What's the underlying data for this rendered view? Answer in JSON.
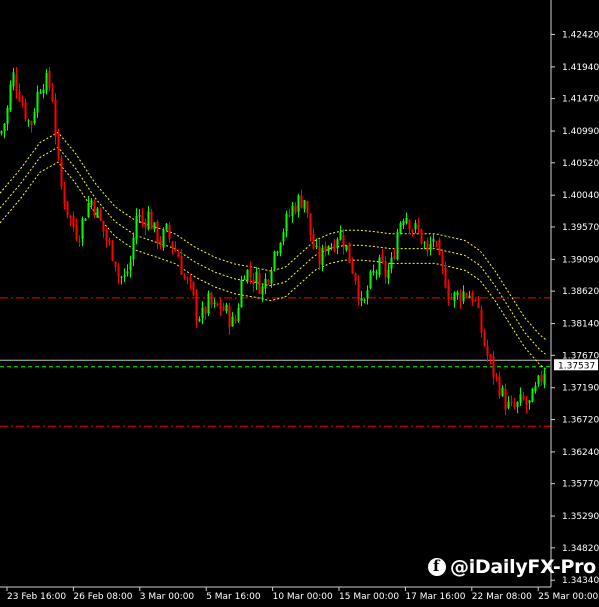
{
  "chart_data": {
    "type": "candlestick",
    "y_ticks": [
      "1.42420",
      "1.41940",
      "1.41470",
      "1.40990",
      "1.40520",
      "1.40040",
      "1.39570",
      "1.39090",
      "1.38620",
      "1.38140",
      "1.37670",
      "1.37190",
      "1.36720",
      "1.36240",
      "1.35770",
      "1.35290",
      "1.34820",
      "1.34340"
    ],
    "x_ticks": [
      "23 Feb 16:00",
      "26 Feb 08:00",
      "3 Mar 00:00",
      "5 Mar 16:00",
      "10 Mar 00:00",
      "15 Mar 00:00",
      "17 Mar 16:00",
      "22 Mar 08:00",
      "25 Mar 00:00"
    ],
    "ylim": [
      1.3424,
      1.4293
    ],
    "current_price": "1.37537",
    "horizontal_lines": [
      {
        "value": 1.3852,
        "color": "#ff0000",
        "style": "dash-dot"
      },
      {
        "value": 1.375,
        "color": "#00ff00",
        "style": "dashed"
      },
      {
        "value": 1.3662,
        "color": "#ff0000",
        "style": "dash-dot"
      }
    ],
    "envelope_color": "#ffff00",
    "bull_color": "#00ff00",
    "bear_color": "#ff0000",
    "close_path": [
      [
        0,
        1.4095
      ],
      [
        6,
        1.412
      ],
      [
        12,
        1.4185
      ],
      [
        18,
        1.416
      ],
      [
        24,
        1.413
      ],
      [
        30,
        1.4105
      ],
      [
        36,
        1.415
      ],
      [
        42,
        1.4175
      ],
      [
        48,
        1.417
      ],
      [
        52,
        1.415
      ],
      [
        56,
        1.408
      ],
      [
        60,
        1.402
      ],
      [
        64,
        1.4
      ],
      [
        68,
        1.3975
      ],
      [
        72,
        1.396
      ],
      [
        78,
        1.3945
      ],
      [
        84,
        1.3975
      ],
      [
        90,
        1.4
      ],
      [
        96,
        1.398
      ],
      [
        102,
        1.3955
      ],
      [
        108,
        1.393
      ],
      [
        114,
        1.3915
      ],
      [
        118,
        1.3885
      ],
      [
        124,
        1.388
      ],
      [
        130,
        1.3905
      ],
      [
        136,
        1.3975
      ],
      [
        142,
        1.3965
      ],
      [
        148,
        1.3975
      ],
      [
        154,
        1.395
      ],
      [
        160,
        1.3935
      ],
      [
        166,
        1.395
      ],
      [
        172,
        1.393
      ],
      [
        178,
        1.3915
      ],
      [
        184,
        1.388
      ],
      [
        190,
        1.3865
      ],
      [
        196,
        1.383
      ],
      [
        202,
        1.3825
      ],
      [
        208,
        1.3845
      ],
      [
        214,
        1.3835
      ],
      [
        220,
        1.384
      ],
      [
        226,
        1.383
      ],
      [
        232,
        1.3815
      ],
      [
        236,
        1.382
      ],
      [
        240,
        1.387
      ],
      [
        244,
        1.3895
      ],
      [
        250,
        1.3885
      ],
      [
        256,
        1.388
      ],
      [
        262,
        1.3865
      ],
      [
        268,
        1.389
      ],
      [
        274,
        1.392
      ],
      [
        280,
        1.3945
      ],
      [
        286,
        1.3965
      ],
      [
        292,
        1.3985
      ],
      [
        298,
        1.3995
      ],
      [
        304,
        1.4
      ],
      [
        308,
        1.396
      ],
      [
        314,
        1.392
      ],
      [
        320,
        1.3905
      ],
      [
        326,
        1.3935
      ],
      [
        332,
        1.393
      ],
      [
        338,
        1.395
      ],
      [
        344,
        1.3935
      ],
      [
        350,
        1.3905
      ],
      [
        356,
        1.388
      ],
      [
        362,
        1.383
      ],
      [
        368,
        1.387
      ],
      [
        374,
        1.389
      ],
      [
        380,
        1.39
      ],
      [
        386,
        1.3885
      ],
      [
        392,
        1.3905
      ],
      [
        398,
        1.396
      ],
      [
        404,
        1.398
      ],
      [
        408,
        1.397
      ],
      [
        412,
        1.3955
      ],
      [
        418,
        1.395
      ],
      [
        424,
        1.393
      ],
      [
        428,
        1.391
      ],
      [
        432,
        1.395
      ],
      [
        436,
        1.392
      ],
      [
        440,
        1.3895
      ],
      [
        444,
        1.3885
      ],
      [
        450,
        1.385
      ],
      [
        456,
        1.3855
      ],
      [
        462,
        1.386
      ],
      [
        468,
        1.386
      ],
      [
        474,
        1.385
      ],
      [
        480,
        1.381
      ],
      [
        486,
        1.377
      ],
      [
        492,
        1.3745
      ],
      [
        498,
        1.3725
      ],
      [
        504,
        1.37
      ],
      [
        510,
        1.3685
      ],
      [
        516,
        1.369
      ],
      [
        522,
        1.37
      ],
      [
        528,
        1.369
      ],
      [
        534,
        1.371
      ],
      [
        540,
        1.373
      ],
      [
        546,
        1.3754
      ]
    ],
    "envelope_mid": [
      [
        0,
        1.3985
      ],
      [
        20,
        1.402
      ],
      [
        40,
        1.406
      ],
      [
        58,
        1.4075
      ],
      [
        75,
        1.4045
      ],
      [
        95,
        1.4
      ],
      [
        115,
        1.3965
      ],
      [
        135,
        1.3945
      ],
      [
        155,
        1.3935
      ],
      [
        175,
        1.3925
      ],
      [
        195,
        1.3905
      ],
      [
        215,
        1.389
      ],
      [
        235,
        1.388
      ],
      [
        255,
        1.3875
      ],
      [
        270,
        1.387
      ],
      [
        285,
        1.3875
      ],
      [
        300,
        1.3895
      ],
      [
        315,
        1.3915
      ],
      [
        330,
        1.3925
      ],
      [
        345,
        1.393
      ],
      [
        360,
        1.393
      ],
      [
        375,
        1.3928
      ],
      [
        390,
        1.3925
      ],
      [
        405,
        1.3925
      ],
      [
        420,
        1.3925
      ],
      [
        435,
        1.3925
      ],
      [
        450,
        1.392
      ],
      [
        465,
        1.3915
      ],
      [
        480,
        1.39
      ],
      [
        495,
        1.387
      ],
      [
        510,
        1.3835
      ],
      [
        525,
        1.38
      ],
      [
        540,
        1.3775
      ],
      [
        546,
        1.3768
      ]
    ],
    "envelope_offset": 0.0022
  },
  "watermark": {
    "text": "@iDailyFX-Pro",
    "icon": "facebook-icon"
  }
}
